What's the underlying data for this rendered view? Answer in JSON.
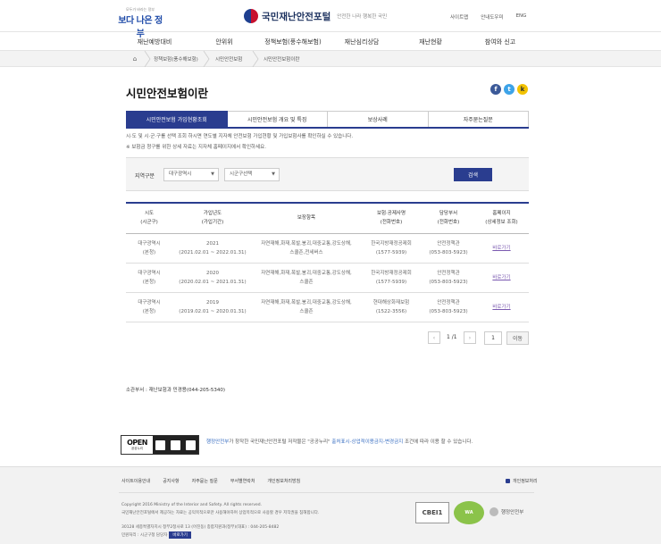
{
  "header": {
    "top_logo_small": "모두가 바라는 정부",
    "top_logo_main": "보다 나은 정부",
    "site_title": "국민재난안전포털",
    "slogan": "안전한 나라 행복한 국민",
    "util_links": [
      "사이트맵",
      "안내도우미",
      "ENG"
    ]
  },
  "gnb": [
    "재난예방대비",
    "안위위",
    "정책보험(풍수해보험)",
    "재난심리상담",
    "재난현황",
    "참여와 신고"
  ],
  "breadcrumb": [
    "정책보험(풍수해보험)",
    "시민안전보험",
    "시민안전보험이란"
  ],
  "page_title": "시민안전보험이란",
  "tabs": [
    {
      "label": "시민안전보험 가입현황조회",
      "active": true
    },
    {
      "label": "시민안전보험 개요 및 특징",
      "active": false
    },
    {
      "label": "보상사례",
      "active": false
    },
    {
      "label": "자주묻는질문",
      "active": false
    }
  ],
  "notices": [
    "시·도 및 시·군·구를 선택 조회 하시면 연도별 지자체 안전보험 가입현황 및 가입보험사를 확인하실 수 있습니다.",
    "※ 보험금 청구를 위한 상세 자료는 지자체 홈페이지에서 확인하세요."
  ],
  "search": {
    "region_label": "지역구분",
    "sido_selected": "대구광역시",
    "sigungu_selected": "시군구선택",
    "button_label": "검색"
  },
  "table": {
    "headers": [
      [
        "시도",
        "(시군구)"
      ],
      [
        "가입년도",
        "(가입기간)"
      ],
      [
        "보장항목",
        ""
      ],
      [
        "보험·공제사명",
        "(전화번호)"
      ],
      [
        "담당부서",
        "(전화번호)"
      ],
      [
        "홈페이지",
        "(상세정보 조회)"
      ]
    ],
    "rows": [
      {
        "sido": "대구광역시",
        "sigungu": "(본청)",
        "year": "2021",
        "period": "(2021.02.01 ~ 2022.01.31)",
        "coverage1": "자연재해,화재,폭발,붕괴,대중교통,강도상해,",
        "coverage2": "스쿨존,전세버스",
        "insurer": "한국지방재정공제회",
        "insurer_tel": "(1577-5939)",
        "dept": "안전정책관",
        "dept_tel": "(053-803-5923)",
        "link": "바로가기"
      },
      {
        "sido": "대구광역시",
        "sigungu": "(본청)",
        "year": "2020",
        "period": "(2020.02.01 ~ 2021.01.31)",
        "coverage1": "자연재해,화재,폭발,붕괴,대중교통,강도상해,",
        "coverage2": "스쿨존",
        "insurer": "한국지방재정공제회",
        "insurer_tel": "(1577-5939)",
        "dept": "안전정책관",
        "dept_tel": "(053-803-5923)",
        "link": "바로가기"
      },
      {
        "sido": "대구광역시",
        "sigungu": "(본청)",
        "year": "2019",
        "period": "(2019.02.01 ~ 2020.01.31)",
        "coverage1": "자연재해,화재,폭발,붕괴,대중교통,강도상해,",
        "coverage2": "스쿨존",
        "insurer": "현대해상화재보험",
        "insurer_tel": "(1522-3556)",
        "dept": "안전정책관",
        "dept_tel": "(053-803-5923)",
        "link": "바로가기"
      }
    ]
  },
  "pagination": {
    "prev": "‹",
    "next": "›",
    "info": "1 /1",
    "page_input": "1",
    "go_label": "이동"
  },
  "dept_info": "소관부서 : 재난보험과 민경용(044-205-5340)",
  "license": {
    "open_label": "OPEN",
    "open_sub": "공공누리",
    "text_pre": "가 창작한 국민재난안전포털 저작물은 \"공공누리\"",
    "hl1": "행정안전부",
    "hl2": "출처표시-상업적이용금지-변경금지",
    "text_post": "조건에 따라 이용 할 수 있습니다."
  },
  "footer": {
    "links": [
      "사이트이용안내",
      "공지사항",
      "자주묻는 질문",
      "부서별연락처",
      "개인정보처리방침"
    ],
    "privacy": "개인정보처리",
    "copyright1": "Copyright 2016 Ministry of the Interior and Safety. All rights reserved.",
    "copyright2": "국민재난안전포털에서 제공하는 자료는 공익목적으로만 사용해야하며 상업목적으로 사용할 경우 저작권을 침해합니다.",
    "address": "30128 세종특별자치시 정부2청사로 13 (어진동)  종합지원과(정부)(대표) : 044-205-8482",
    "accessibility_text": "민원처리 : 시군구청 담당자",
    "accessibility_btn": "바로가기",
    "cert1": "CBEI1",
    "cert2": "WA",
    "ministry": "행정안전부"
  },
  "colors": {
    "primary": "#2a3d8f",
    "link": "#7b5ab0"
  }
}
